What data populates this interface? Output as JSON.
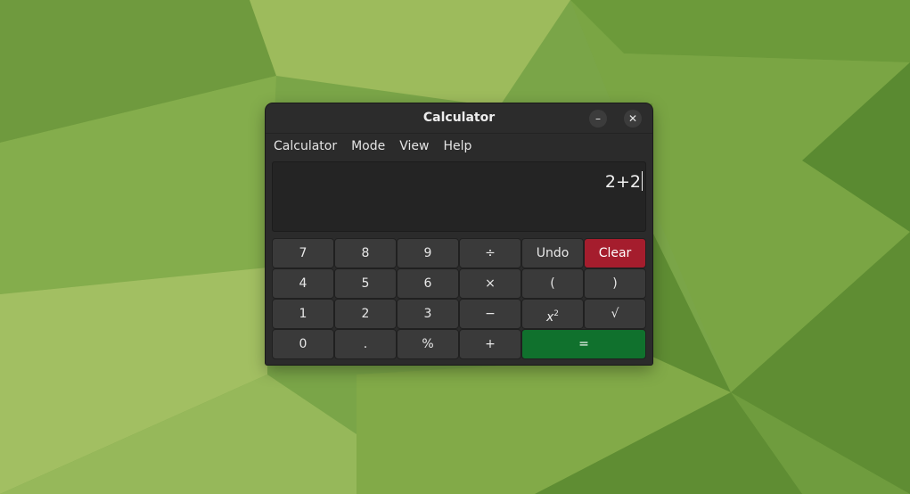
{
  "window": {
    "title": "Calculator",
    "minimize_glyph": "–",
    "close_glyph": "✕"
  },
  "menu": [
    "Calculator",
    "Mode",
    "View",
    "Help"
  ],
  "display": {
    "expression": "2+2"
  },
  "keys": [
    [
      "7",
      "8",
      "9",
      "÷",
      "Undo",
      "Clear"
    ],
    [
      "4",
      "5",
      "6",
      "×",
      "(",
      ")"
    ],
    [
      "1",
      "2",
      "3",
      "−",
      "x²",
      "√"
    ],
    [
      "0",
      ".",
      "%",
      "+",
      "="
    ]
  ],
  "square_key": {
    "base": "x",
    "exponent": "2"
  },
  "colors": {
    "clear_button": "#a51d2d",
    "equals_button": "#10712d",
    "window_bg": "#2b2b2b",
    "wallpaper": "#7aa548"
  }
}
